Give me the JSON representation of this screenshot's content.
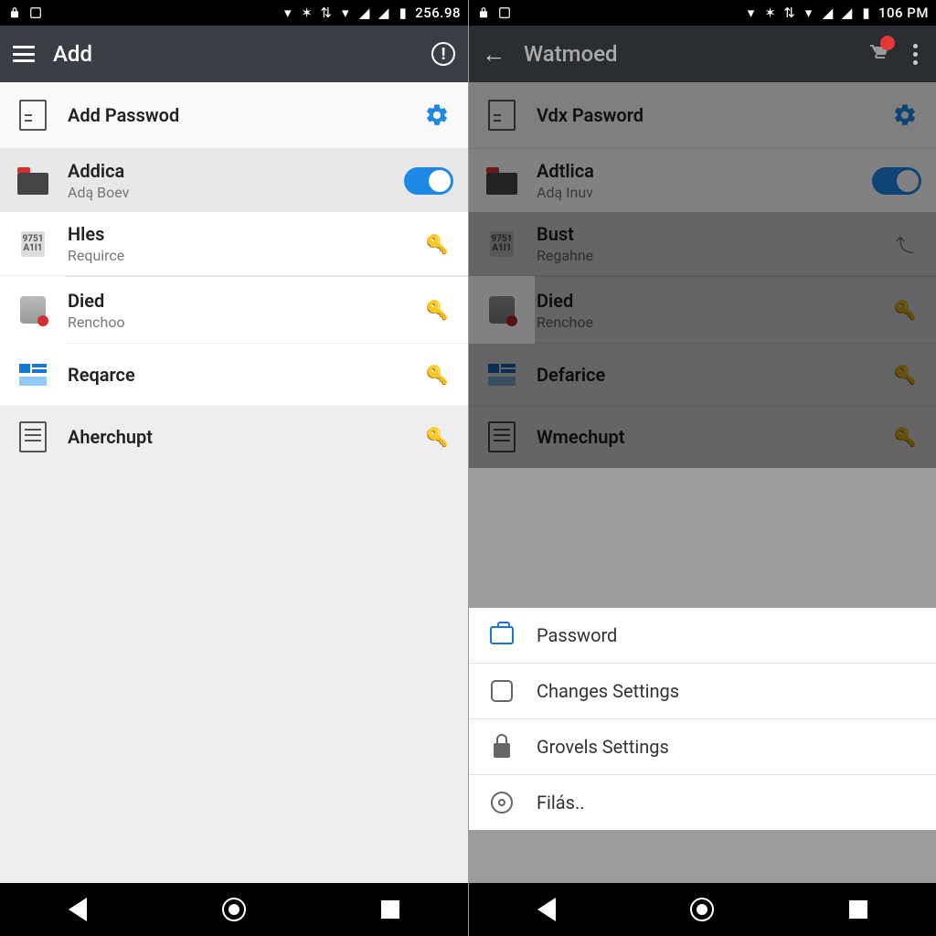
{
  "left": {
    "status": {
      "time": "256.98"
    },
    "appbar": {
      "title": "Add"
    },
    "header": {
      "title": "Add Passwod"
    },
    "toggle_row": {
      "title": "Addica",
      "sub": "Adą Boev"
    },
    "items": [
      {
        "title": "Hles",
        "sub": "Requirce"
      },
      {
        "title": "Died",
        "sub": "Renchoo"
      },
      {
        "title": "Reqarce",
        "sub": ""
      },
      {
        "title": "Aherchupt",
        "sub": ""
      }
    ]
  },
  "right": {
    "status": {
      "time": "106 PM"
    },
    "appbar": {
      "title": "Watmoed"
    },
    "header": {
      "title": "Vdx Pasword"
    },
    "toggle_row": {
      "title": "Adtlica",
      "sub": "Adą Inuv"
    },
    "items": [
      {
        "title": "Bust",
        "sub": "Regahne"
      },
      {
        "title": "Died",
        "sub": "Renchoe"
      },
      {
        "title": "Defarice",
        "sub": ""
      },
      {
        "title": "Wmechupt",
        "sub": ""
      }
    ],
    "sheet": [
      "Password",
      "Changes Settings",
      "Grovels Settings",
      "Filás.."
    ]
  }
}
